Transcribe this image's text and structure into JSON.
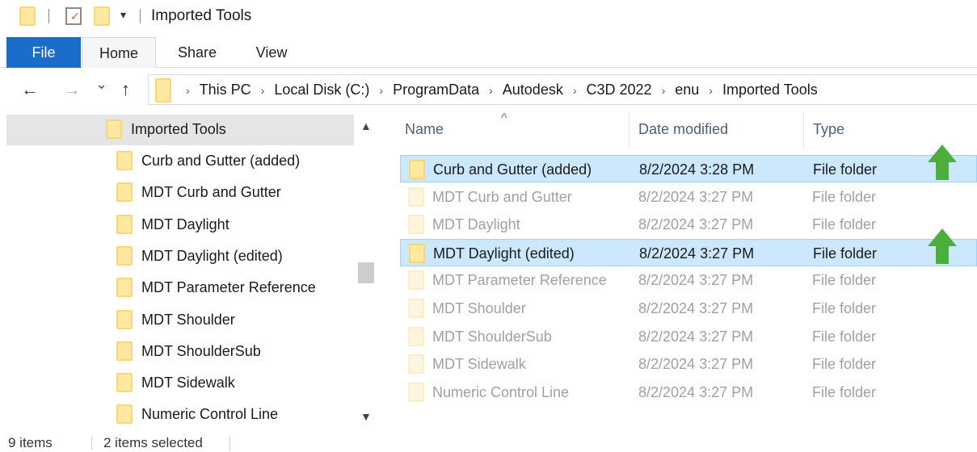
{
  "window": {
    "title": "Imported Tools"
  },
  "ribbon": {
    "tabs": [
      {
        "label": "File"
      },
      {
        "label": "Home"
      },
      {
        "label": "Share"
      },
      {
        "label": "View"
      }
    ]
  },
  "navigation": {
    "back_icon": "←",
    "forward_icon": "→",
    "recent_icon": "⌄",
    "up_icon": "↑"
  },
  "breadcrumb": [
    "This PC",
    "Local Disk (C:)",
    "ProgramData",
    "Autodesk",
    "C3D 2022",
    "enu",
    "Imported Tools"
  ],
  "nav_pane": {
    "root": "Imported Tools",
    "items": [
      "Curb and Gutter (added)",
      "MDT Curb and Gutter",
      "MDT Daylight",
      "MDT Daylight (edited)",
      "MDT Parameter Reference",
      "MDT Shoulder",
      "MDT ShoulderSub",
      "MDT Sidewalk",
      "Numeric Control Line"
    ]
  },
  "columns": {
    "name": "Name",
    "date": "Date modified",
    "type": "Type"
  },
  "files": [
    {
      "name": "Curb and Gutter (added)",
      "date": "8/2/2024 3:28 PM",
      "type": "File folder",
      "selected": true,
      "marker": true
    },
    {
      "name": "MDT Curb and Gutter",
      "date": "8/2/2024 3:27 PM",
      "type": "File folder",
      "selected": false,
      "marker": false
    },
    {
      "name": "MDT Daylight",
      "date": "8/2/2024 3:27 PM",
      "type": "File folder",
      "selected": false,
      "marker": false
    },
    {
      "name": "MDT Daylight (edited)",
      "date": "8/2/2024 3:27 PM",
      "type": "File folder",
      "selected": true,
      "marker": true
    },
    {
      "name": "MDT Parameter Reference",
      "date": "8/2/2024 3:27 PM",
      "type": "File folder",
      "selected": false,
      "marker": false
    },
    {
      "name": "MDT Shoulder",
      "date": "8/2/2024 3:27 PM",
      "type": "File folder",
      "selected": false,
      "marker": false
    },
    {
      "name": "MDT ShoulderSub",
      "date": "8/2/2024 3:27 PM",
      "type": "File folder",
      "selected": false,
      "marker": false
    },
    {
      "name": "MDT Sidewalk",
      "date": "8/2/2024 3:27 PM",
      "type": "File folder",
      "selected": false,
      "marker": false
    },
    {
      "name": "Numeric Control Line",
      "date": "8/2/2024 3:27 PM",
      "type": "File folder",
      "selected": false,
      "marker": false
    }
  ],
  "status": {
    "count": "9 items",
    "selection": "2 items selected"
  },
  "colors": {
    "accent": "#1a6dc8",
    "selection": "#cce8ff",
    "marker_arrow": "#4caf3c"
  }
}
